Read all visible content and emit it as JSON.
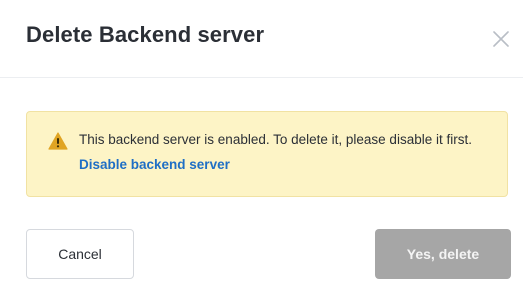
{
  "dialog": {
    "title": "Delete Backend server",
    "close_icon": "close-icon"
  },
  "alert": {
    "icon": "warning-triangle-icon",
    "message": "This backend server is enabled. To delete it, please disable it first.",
    "link_label": "Disable backend server"
  },
  "footer": {
    "cancel_label": "Cancel",
    "delete_label": "Yes, delete",
    "delete_disabled": true
  },
  "colors": {
    "alert_background": "#fdf4c6",
    "warning_icon": "#e0a423",
    "link": "#1f6fc5",
    "disabled_button": "#a6a6a6"
  }
}
